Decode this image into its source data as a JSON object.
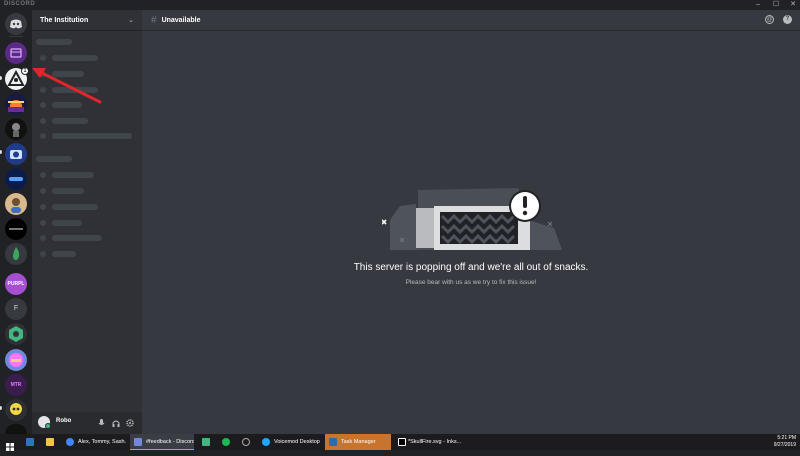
{
  "titlebar": {
    "brand": "DISCORD",
    "minimize": "–",
    "maximize": "☐",
    "close": "✕"
  },
  "server": {
    "name": "The Institution",
    "chevron": "⌄"
  },
  "channel": {
    "hash": "#",
    "name": "Unavailable"
  },
  "header_icons": {
    "mention": "@",
    "help": "?"
  },
  "empty_state": {
    "title": "This server is popping off and we're all out of snacks.",
    "subtitle": "Please bear with us as we try to fix this issue!"
  },
  "user": {
    "name": "Robo"
  },
  "guild_badges": {
    "vrchat": "1",
    "purpl": "PURPL",
    "f": "F",
    "mtr": "MTR"
  },
  "taskbar": {
    "items": [
      {
        "label": "Alex, Tommy, Sash..."
      },
      {
        "label": "#feedback - Discord"
      },
      {
        "label": "Voicemod Desktop"
      },
      {
        "label": "Task Manager"
      },
      {
        "label": "*SkullFire.svg - Inks..."
      }
    ],
    "time": "5:21 PM",
    "date": "9/27/2019"
  },
  "colors": {
    "background": "#36393f",
    "sidebar": "#2f3136",
    "guild_bar": "#202225",
    "arrow": "#e3242b",
    "online": "#43b581"
  }
}
